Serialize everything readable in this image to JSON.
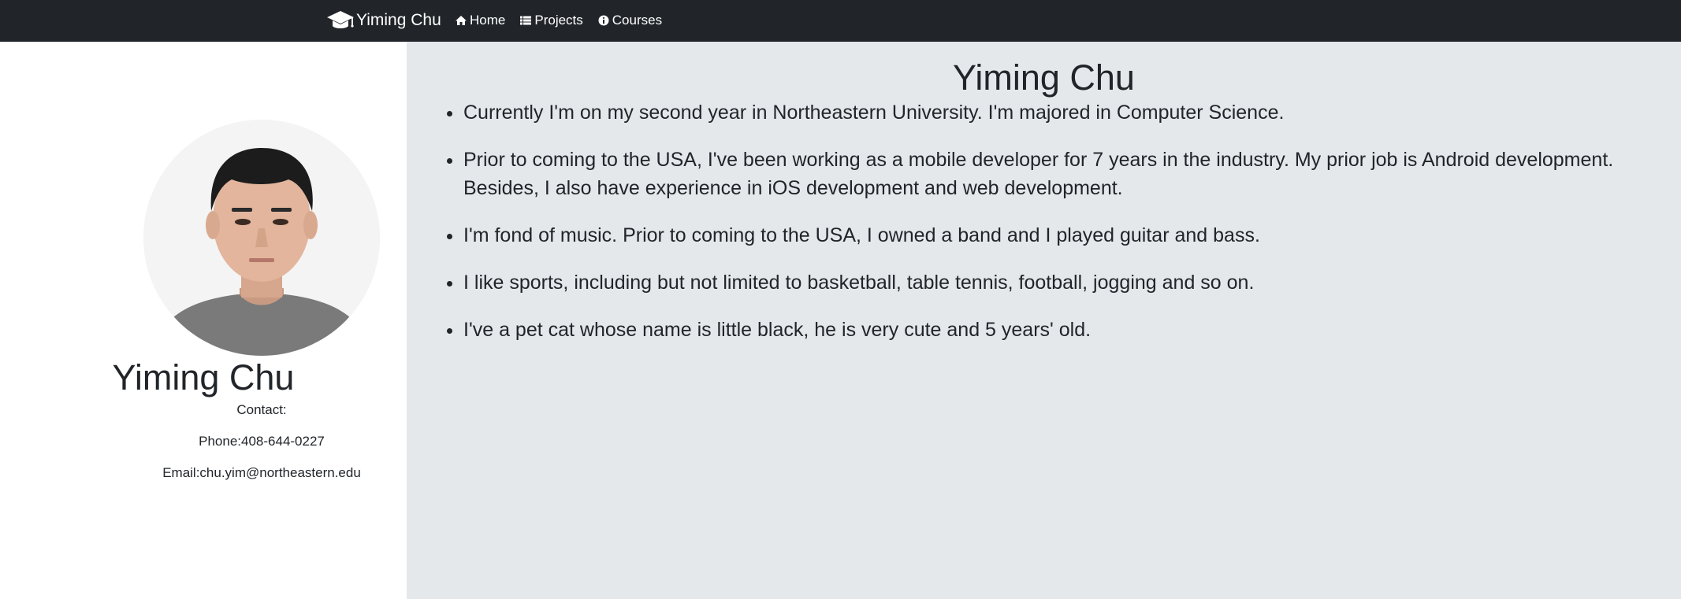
{
  "navbar": {
    "brand": "Yiming Chu",
    "links": [
      {
        "label": "Home",
        "icon": "home-icon"
      },
      {
        "label": "Projects",
        "icon": "list-icon"
      },
      {
        "label": "Courses",
        "icon": "info-circle-icon"
      }
    ]
  },
  "sidebar": {
    "name": "Yiming Chu",
    "contact_label": "Contact:",
    "phone": "Phone:408-644-0227",
    "email": "Email:chu.yim@northeastern.edu"
  },
  "main": {
    "title": "Yiming Chu",
    "bio": [
      "Currently I'm on my second year in Northeastern University. I'm majored in Computer Science.",
      "Prior to coming to the USA, I've been working as a mobile developer for 7 years in the industry. My prior job is Android development. Besides, I also have experience in iOS development and web development.",
      "I'm fond of music. Prior to coming to the USA, I owned a band and I played guitar and bass.",
      "I like sports, including but not limited to basketball, table tennis, football, jogging and so on.",
      "I've a pet cat whose name is little black, he is very cute and 5 years' old."
    ]
  },
  "colors": {
    "navbar_bg": "#212529",
    "main_bg": "#e5e8eb",
    "text": "#212529"
  }
}
